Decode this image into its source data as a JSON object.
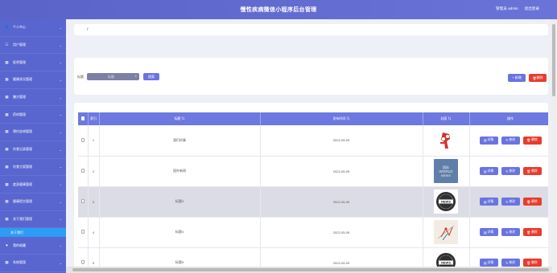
{
  "header": {
    "title": "慢性疾病微信小程序后台管理",
    "user_label": "管理员 admin",
    "logout_label": "退出登录"
  },
  "sidebar": {
    "items": [
      {
        "label": "个人中心",
        "icon": "user-icon"
      },
      {
        "label": "用户管理",
        "icon": "people-icon"
      },
      {
        "label": "医师管理",
        "icon": "grid-icon"
      },
      {
        "label": "健康状况管理",
        "icon": "grid-icon"
      },
      {
        "label": "膳方管理",
        "icon": "grid-icon"
      },
      {
        "label": "药材管理",
        "icon": "grid-icon"
      },
      {
        "label": "预约咨询管理",
        "icon": "grid-icon"
      },
      {
        "label": "饮食记录管理",
        "icon": "grid-icon"
      },
      {
        "label": "饮食方案管理",
        "icon": "grid-icon"
      },
      {
        "label": "度身健康管理",
        "icon": "grid-icon"
      },
      {
        "label": "健康提交管理",
        "icon": "grid-icon"
      },
      {
        "label": "关于我们管理",
        "icon": "grid-icon"
      }
    ],
    "sub_item": "关于我们",
    "after_items": [
      {
        "label": "我的收藏",
        "icon": "heart-icon"
      },
      {
        "label": "系统管理",
        "icon": "grid-icon"
      }
    ]
  },
  "breadcrumb": {
    "sep": "/"
  },
  "search": {
    "label": "标题",
    "placeholder": "标题",
    "search_button": "搜索",
    "add_button": "+ 新增",
    "delete_button": "删除"
  },
  "table": {
    "headers": [
      "",
      "索引",
      "标题 ⇅",
      "发布时间 ⇅",
      "封面 ⇅",
      "操作"
    ],
    "rows": [
      {
        "index": "1",
        "title": "我们的事",
        "date": "2022-05-09",
        "cover": "red-figure"
      },
      {
        "index": "2",
        "title": "国外新闻",
        "date": "2022-05-09",
        "cover": "world-news"
      },
      {
        "index": "3",
        "title": "标题3",
        "date": "2022-05-09",
        "cover": "news-badge"
      },
      {
        "index": "4",
        "title": "标题4",
        "date": "2022-05-09",
        "cover": "drawing"
      },
      {
        "index": "5",
        "title": "标题5",
        "date": "2022-05-09",
        "cover": "news-badge"
      }
    ],
    "cover_text": {
      "world1": "国际",
      "world2": "WORLD",
      "world3": "NEWS",
      "badge": "NEWS"
    },
    "ops": {
      "detail": "详情",
      "edit": "修改",
      "delete": "删除"
    }
  },
  "colors": {
    "primary": "#6a74e0",
    "danger": "#e83c2c",
    "sidebar": "#5966d0",
    "active": "#2d9cf5"
  }
}
